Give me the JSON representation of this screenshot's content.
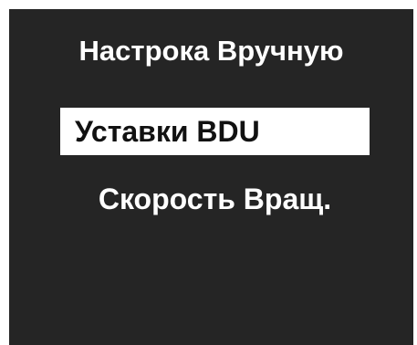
{
  "screen": {
    "background_color": "#252525",
    "text_color": "#ffffff",
    "selection_background": "#ffffff",
    "selection_text_color": "#111111"
  },
  "menu": {
    "title": "Настрока Вручную",
    "items": [
      {
        "label": "Уставки BDU",
        "selected": true
      },
      {
        "label": "Скорость Вращ.",
        "selected": false
      }
    ]
  }
}
